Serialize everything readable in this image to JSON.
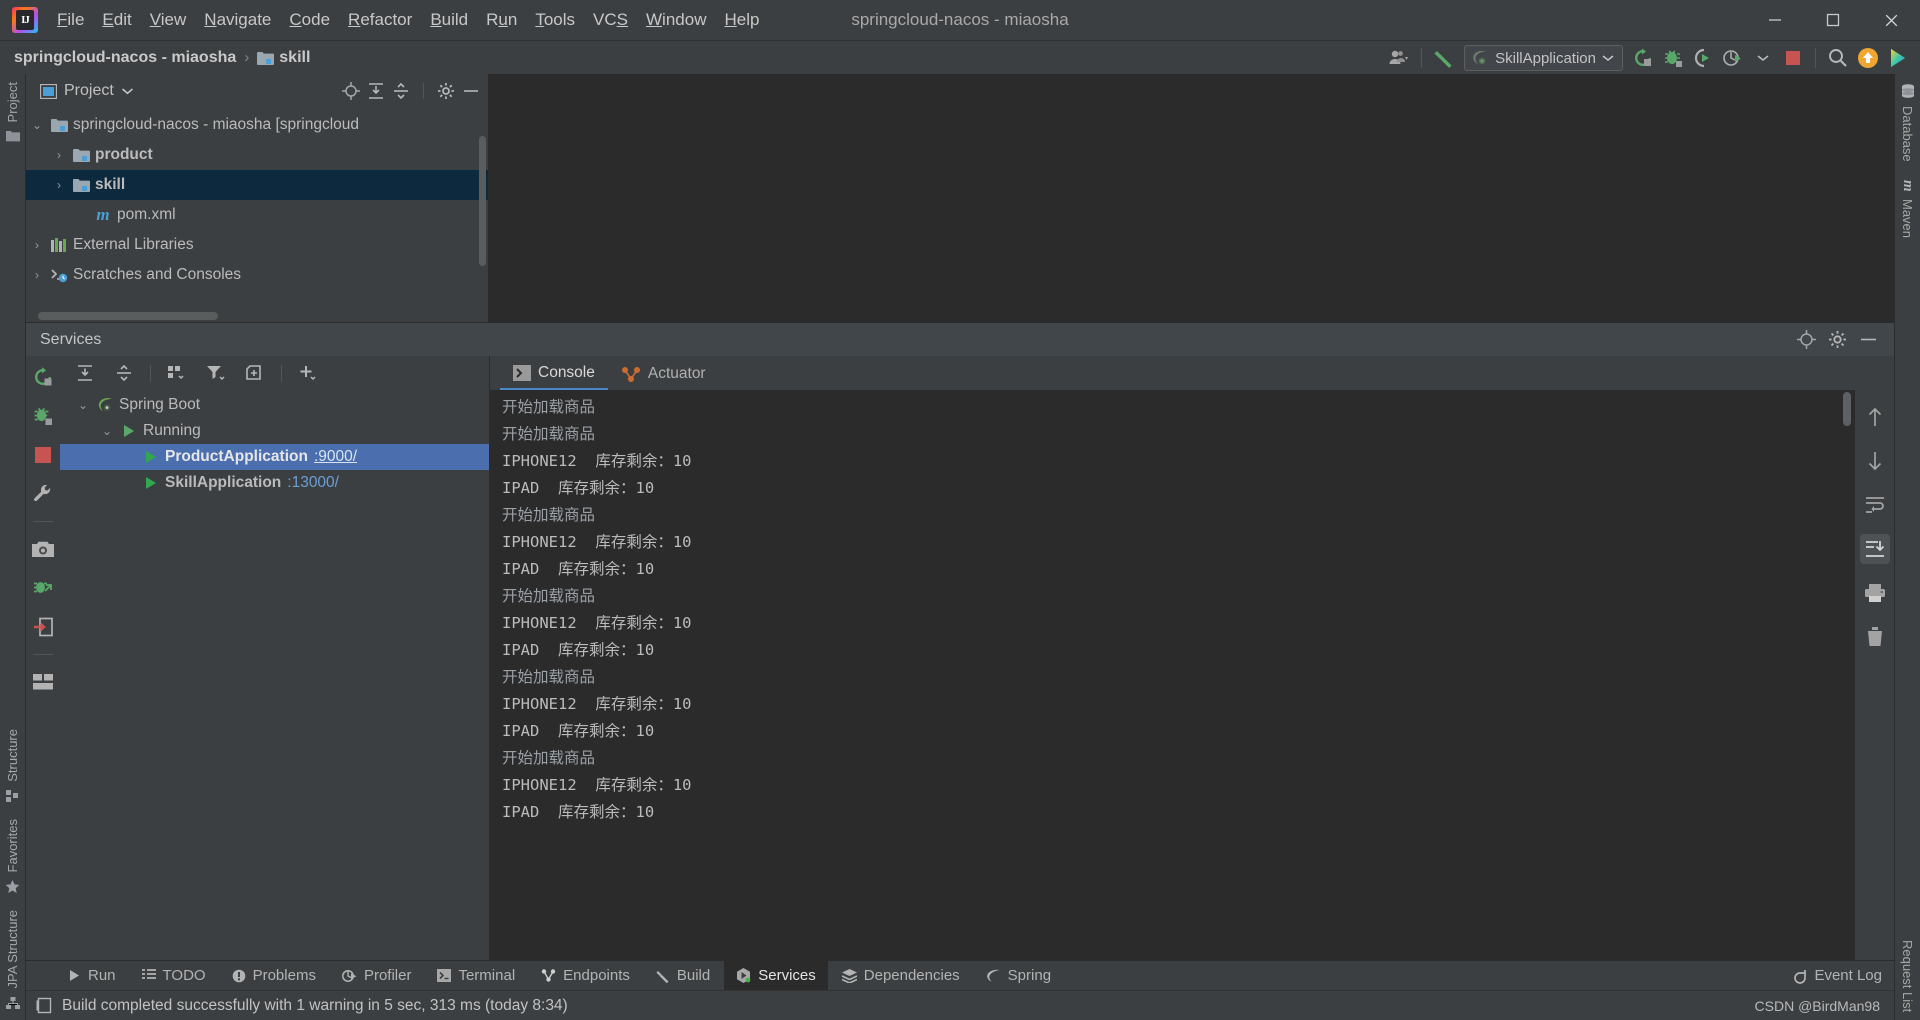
{
  "window": {
    "title": "springcloud-nacos - miaosha",
    "logo_text": "IJ",
    "controls": {
      "minimize": "minimize-icon",
      "maximize": "maximize-icon",
      "close": "close-icon"
    }
  },
  "menubar": {
    "items": [
      {
        "label": "File",
        "mnemonic": "F"
      },
      {
        "label": "Edit",
        "mnemonic": "E"
      },
      {
        "label": "View",
        "mnemonic": "V"
      },
      {
        "label": "Navigate",
        "mnemonic": "N"
      },
      {
        "label": "Code",
        "mnemonic": "C"
      },
      {
        "label": "Refactor",
        "mnemonic": "R"
      },
      {
        "label": "Build",
        "mnemonic": "B"
      },
      {
        "label": "Run",
        "mnemonic": "u"
      },
      {
        "label": "Tools",
        "mnemonic": "T"
      },
      {
        "label": "VCS",
        "mnemonic": "S"
      },
      {
        "label": "Window",
        "mnemonic": "W"
      },
      {
        "label": "Help",
        "mnemonic": "H"
      }
    ]
  },
  "toolbar": {
    "breadcrumb_project": "springcloud-nacos - miaosha",
    "breadcrumb_separator": "›",
    "breadcrumb_module": "skill",
    "run_config": "SkillApplication",
    "icons": [
      "user-account-icon",
      "build-hammer-icon",
      "rerun-icon",
      "debug-icon",
      "run-with-coverage-icon",
      "profiler-icon",
      "stop-icon",
      "search-icon",
      "update-project-icon",
      "ide-feature-icon"
    ]
  },
  "left_strip": {
    "top": [
      {
        "label": "Project",
        "icon": "project-icon"
      }
    ],
    "bottom": [
      {
        "label": "Structure",
        "icon": "structure-icon"
      },
      {
        "label": "Favorites",
        "icon": "star-icon"
      },
      {
        "label": "JPA Structure",
        "icon": "jpa-icon"
      }
    ]
  },
  "right_strip": {
    "top": [
      {
        "label": "Database",
        "icon": "database-icon"
      },
      {
        "label": "Maven",
        "icon": "maven-icon"
      }
    ],
    "bottom": [
      {
        "label": "Request List",
        "icon": "request-list-icon"
      }
    ]
  },
  "project_panel": {
    "title": "Project",
    "header_icons": [
      "locate-icon",
      "expand-all-icon",
      "collapse-all-icon",
      "gear-icon",
      "hide-icon"
    ],
    "tree": [
      {
        "label": "springcloud-nacos - miaosha [springcloud",
        "icon": "module-folder-icon",
        "depth": 0,
        "twisty": "down",
        "selected": false,
        "bold_tail": "[springcloud"
      },
      {
        "label": "product",
        "icon": "module-folder-icon",
        "depth": 1,
        "twisty": "right",
        "selected": false,
        "bold": true
      },
      {
        "label": "skill",
        "icon": "module-folder-icon",
        "depth": 1,
        "twisty": "right",
        "selected": true,
        "bold": true
      },
      {
        "label": "pom.xml",
        "icon": "maven-file-icon",
        "depth": 2,
        "twisty": "none",
        "selected": false
      },
      {
        "label": "External Libraries",
        "icon": "libraries-icon",
        "depth": 0,
        "twisty": "right",
        "selected": false
      },
      {
        "label": "Scratches and Consoles",
        "icon": "scratches-icon",
        "depth": 0,
        "twisty": "right",
        "selected": false
      }
    ]
  },
  "services": {
    "title": "Services",
    "header_icons": [
      "locate-icon",
      "gear-icon",
      "hide-icon"
    ],
    "left_tool_icons": [
      "rerun-icon",
      "debug-icon",
      "stop-icon",
      "settings-wrench-icon",
      "camera-icon",
      "attach-debugger-icon",
      "exit-icon",
      "layout-icon"
    ],
    "tree_toolbar_icons": [
      "expand-all-icon",
      "collapse-all-icon",
      "group-by-icon",
      "filter-icon",
      "add-tab-icon",
      "add-service-icon"
    ],
    "tree": [
      {
        "label": "Spring Boot",
        "icon": "spring-boot-icon",
        "depth": 0,
        "twisty": "down",
        "selected": false
      },
      {
        "label": "Running",
        "icon": "run-green-icon",
        "depth": 1,
        "twisty": "down",
        "selected": false
      },
      {
        "label": "ProductApplication",
        "port": ":9000/",
        "icon": "run-green-icon",
        "depth": 2,
        "twisty": "none",
        "selected": true
      },
      {
        "label": "SkillApplication",
        "port": ":13000/",
        "icon": "run-green-icon",
        "depth": 2,
        "twisty": "none",
        "selected": false
      }
    ],
    "console_tabs": [
      {
        "label": "Console",
        "icon": "console-icon",
        "active": true
      },
      {
        "label": "Actuator",
        "icon": "actuator-icon",
        "active": false
      }
    ],
    "console_side_icons": [
      "scroll-up-icon",
      "scroll-down-icon",
      "soft-wrap-icon",
      "scroll-to-end-icon",
      "print-icon",
      "clear-all-icon"
    ],
    "console_lines": [
      {
        "text": "开始加载商品",
        "dim": true
      },
      {
        "text": "开始加载商品",
        "dim": true
      },
      {
        "text": "IPHONE12  库存剩余：10",
        "dim": false
      },
      {
        "text": "IPAD  库存剩余：10",
        "dim": false
      },
      {
        "text": "开始加载商品",
        "dim": true
      },
      {
        "text": "IPHONE12  库存剩余：10",
        "dim": false
      },
      {
        "text": "IPAD  库存剩余：10",
        "dim": false
      },
      {
        "text": "开始加载商品",
        "dim": true
      },
      {
        "text": "IPHONE12  库存剩余：10",
        "dim": false
      },
      {
        "text": "IPAD  库存剩余：10",
        "dim": false
      },
      {
        "text": "开始加载商品",
        "dim": true
      },
      {
        "text": "IPHONE12  库存剩余：10",
        "dim": false
      },
      {
        "text": "IPAD  库存剩余：10",
        "dim": false
      },
      {
        "text": "开始加载商品",
        "dim": true
      },
      {
        "text": "IPHONE12  库存剩余：10",
        "dim": false
      },
      {
        "text": "IPAD  库存剩余：10",
        "dim": false
      }
    ]
  },
  "bottom_tabs": [
    {
      "label": "Run",
      "icon": "run-icon",
      "active": false
    },
    {
      "label": "TODO",
      "icon": "todo-icon",
      "active": false
    },
    {
      "label": "Problems",
      "icon": "problems-icon",
      "active": false
    },
    {
      "label": "Profiler",
      "icon": "profiler-icon",
      "active": false
    },
    {
      "label": "Terminal",
      "icon": "terminal-icon",
      "active": false
    },
    {
      "label": "Endpoints",
      "icon": "endpoints-icon",
      "active": false
    },
    {
      "label": "Build",
      "icon": "build-icon",
      "active": false
    },
    {
      "label": "Services",
      "icon": "services-icon",
      "active": true
    },
    {
      "label": "Dependencies",
      "icon": "dependencies-icon",
      "active": false
    },
    {
      "label": "Spring",
      "icon": "spring-icon",
      "active": false
    }
  ],
  "event_log": {
    "label": "Event Log",
    "icon": "event-log-icon"
  },
  "statusbar": {
    "icon": "memory-icon",
    "message": "Build completed successfully with 1 warning in 5 sec, 313 ms (today 8:34)",
    "watermark": "CSDN @BirdMan98"
  },
  "colors": {
    "bg": "#3c3f41",
    "editor_bg": "#2b2b2b",
    "selection_blue": "#4b6eaf",
    "tree_selection": "#0d293e",
    "accent_green": "#59a869",
    "accent_red": "#c75450",
    "link_blue": "#6c9fd6"
  }
}
